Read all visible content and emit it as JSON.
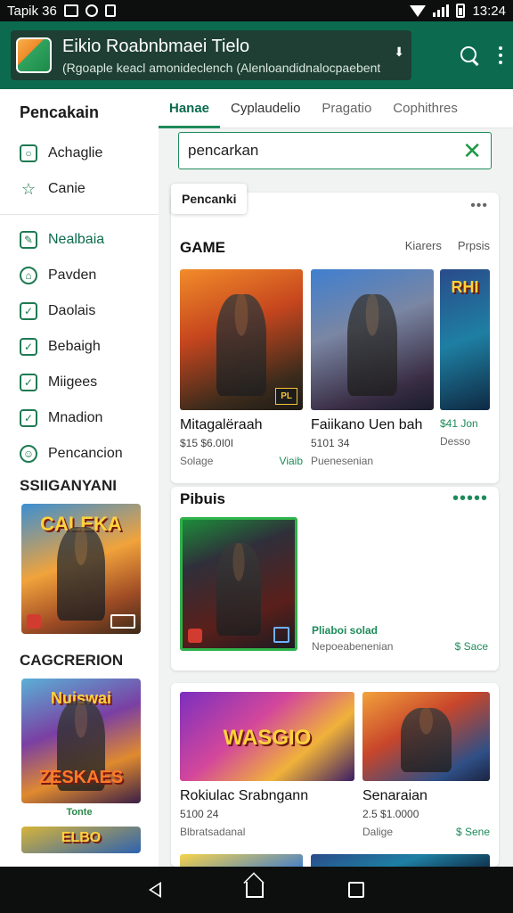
{
  "statusbar": {
    "left_text": "Tapik 36",
    "time": "13:24"
  },
  "appbar": {
    "title": "Eikio Roabnbmaei Tielo",
    "subtitle": "(Rgoaple keacl amonideclench (Alenloandidnalocpaebent"
  },
  "tabs": [
    "Hanae",
    "Cyplaudelio",
    "Pragatio",
    "Cophithres"
  ],
  "search": {
    "value": "pencarkan"
  },
  "sidebar": {
    "header": "Pencakain",
    "items_top": [
      {
        "label": "Achaglie",
        "icon": "checkbox-icon"
      },
      {
        "label": "Canie",
        "icon": "person-icon"
      }
    ],
    "items": [
      {
        "label": "Nealbaia",
        "icon": "edit-icon"
      },
      {
        "label": "Pavden",
        "icon": "home-icon"
      },
      {
        "label": "Daolais",
        "icon": "checkbox-icon"
      },
      {
        "label": "Bebaigh",
        "icon": "checkbox-icon"
      },
      {
        "label": "Miigees",
        "icon": "checkbox-icon"
      },
      {
        "label": "Mnadion",
        "icon": "checkbox-icon"
      },
      {
        "label": "Pencancion",
        "icon": "shield-icon"
      }
    ],
    "section1": "SSIIGANYANI",
    "card1_word": "CALEKA",
    "section2": "CAGCRERION",
    "card2_word_top": "Nuiswai",
    "card2_word_bottom": "ZESKAES",
    "card2_caption": "Tonte",
    "card3_word": "ELBO"
  },
  "panel1": {
    "chip": "Pencanki",
    "title": "GAME",
    "links": [
      "Kiarers",
      "Prpsis"
    ],
    "games": [
      {
        "name": "Mitagalёraah",
        "price": "$15 $6.0I0I",
        "meta_left": "Solage",
        "meta_right": "Viaib",
        "logo": "PL"
      },
      {
        "name": "Faiikano Uen bah",
        "price": "5101 34",
        "meta_left": "Puenesenian",
        "meta_right": ""
      },
      {
        "name": "",
        "price": "$41 Jon",
        "meta_left": "",
        "meta_right": "Desso",
        "art_word": "RHI"
      }
    ]
  },
  "panel2": {
    "title": "Pibuis",
    "game": {
      "rating": "Pliaboi solad",
      "sub": "Nepoeabenenian",
      "price": "$ Sace"
    }
  },
  "panel3": {
    "games": [
      {
        "name": "Rokiulac Srabngann",
        "price": "5100 24",
        "meta_left": "Blbratsadanal",
        "meta_right": "",
        "art_word": "WASGIO"
      },
      {
        "name": "Senaraian",
        "price": "2.5 $1.0000",
        "meta_left": "Dalige",
        "meta_right": "$ Sene"
      }
    ]
  },
  "colors": {
    "primary": "#0c6b4e",
    "accent": "#1e8a5a",
    "bar": "#0d0f0e"
  }
}
